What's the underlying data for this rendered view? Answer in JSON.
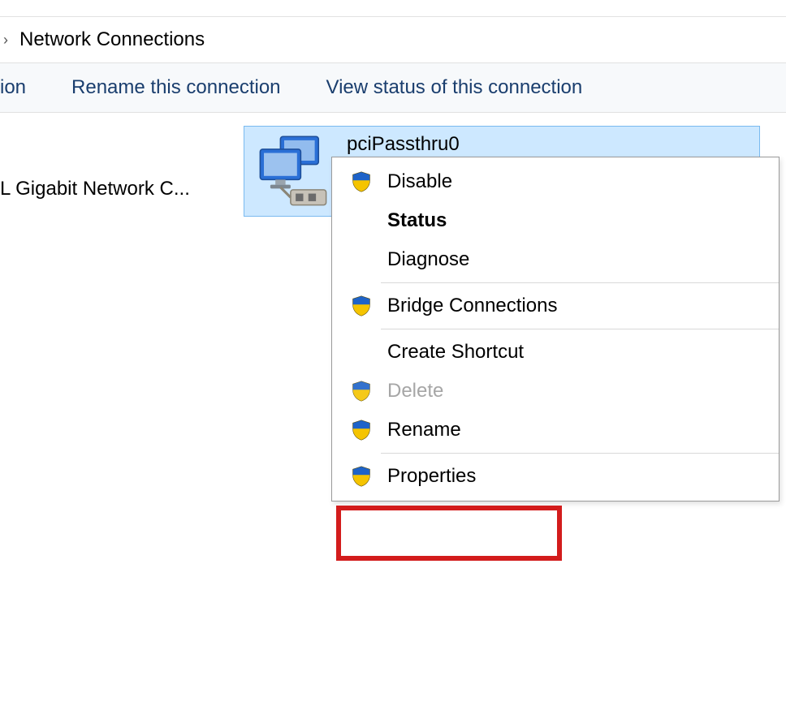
{
  "breadcrumb": {
    "separator": "›",
    "title": "Network Connections"
  },
  "toolbar": {
    "item_trunc": "ion",
    "rename": "Rename this connection",
    "view_status": "View status of this connection"
  },
  "adapters": {
    "left_trunc_label": "L Gigabit Network C...",
    "selected_name": "pciPassthru0"
  },
  "context_menu": {
    "disable": "Disable",
    "status": "Status",
    "diagnose": "Diagnose",
    "bridge": "Bridge Connections",
    "create_shortcut": "Create Shortcut",
    "delete": "Delete",
    "rename": "Rename",
    "properties": "Properties"
  }
}
